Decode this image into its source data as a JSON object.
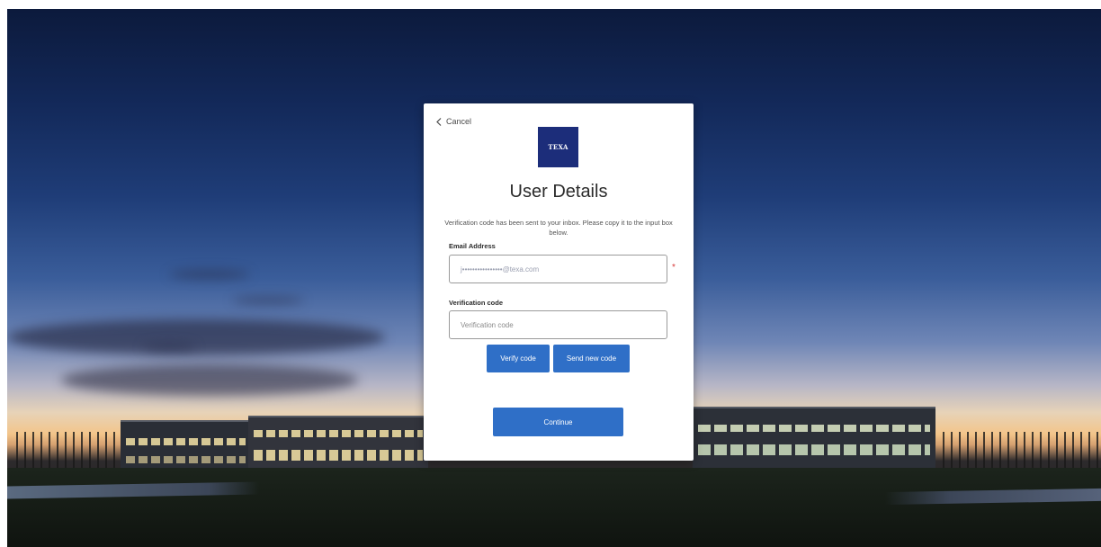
{
  "card": {
    "cancel_label": "Cancel",
    "logo_text": "TEXA",
    "title": "User Details",
    "intro": "Verification code has been sent to your inbox. Please copy it to the input box below.",
    "email": {
      "label": "Email Address",
      "value": "j••••••••••••••••@texa.com",
      "required_mark": "*"
    },
    "verification": {
      "label": "Verification code",
      "placeholder": "Verification code"
    },
    "buttons": {
      "verify": "Verify code",
      "send_new": "Send new code",
      "continue": "Continue"
    }
  },
  "colors": {
    "primary_button": "#2f6fc7",
    "logo_background": "#1c2d7a",
    "required": "#d83b3b"
  },
  "icons": {
    "cancel": "chevron-left-icon"
  }
}
